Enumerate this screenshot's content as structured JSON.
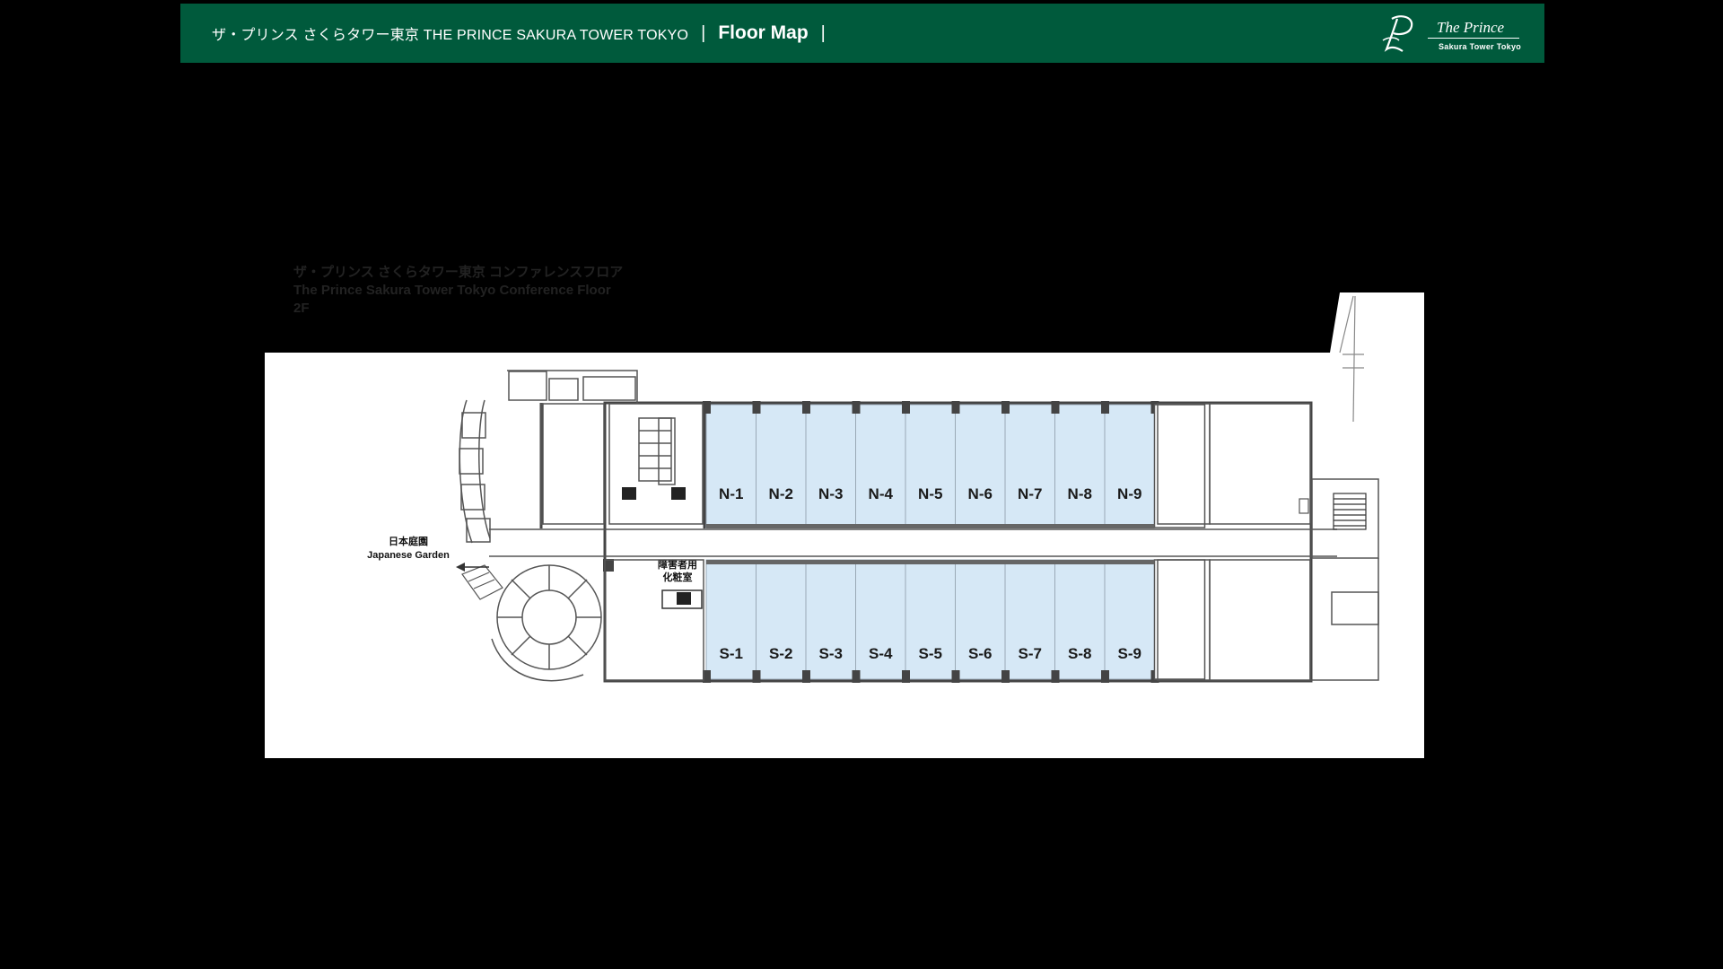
{
  "header": {
    "hotel_name": "ザ・プリンス さくらタワー東京 THE PRINCE SAKURA TOWER TOKYO",
    "separator": "|",
    "page_title": "Floor Map"
  },
  "logo": {
    "title": "The Prince",
    "subtitle": "Sakura Tower Tokyo",
    "icon": "prince-monogram-icon"
  },
  "caption": {
    "line_jp": "ザ・プリンス さくらタワー東京 コンファレンスフロア",
    "line_en": "The Prince Sakura Tower Tokyo Conference Floor",
    "floor": "2F"
  },
  "map": {
    "north_rooms": [
      "N-1",
      "N-2",
      "N-3",
      "N-4",
      "N-5",
      "N-6",
      "N-7",
      "N-8",
      "N-9"
    ],
    "south_rooms": [
      "S-1",
      "S-2",
      "S-3",
      "S-4",
      "S-5",
      "S-6",
      "S-7",
      "S-8",
      "S-9"
    ],
    "garden_label_jp": "日本庭園",
    "garden_label_en": "Japanese Garden",
    "restroom_label_line1": "障害者用",
    "restroom_label_line2": "化粧室",
    "room_color": "#d6e8f6",
    "wall_color": "#444444",
    "icons": [
      "elevator-icon",
      "restroom-icon",
      "stairs-icon",
      "spiral-staircase-icon",
      "north-arrow-icon"
    ]
  },
  "colors": {
    "header_bg": "#005a3c",
    "page_bg": "#000000",
    "map_bg": "#ffffff"
  }
}
